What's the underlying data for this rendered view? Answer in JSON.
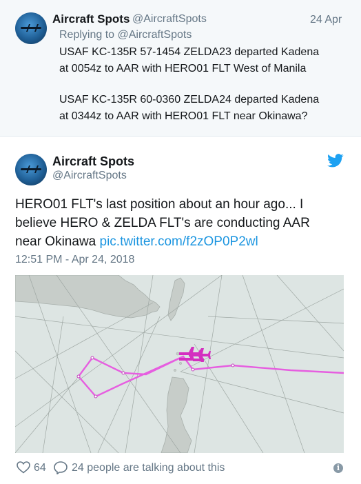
{
  "reply_tweet": {
    "name": "Aircraft Spots",
    "handle": "@AircraftSpots",
    "date": "24 Apr",
    "replying_to": "Replying to @AircraftSpots",
    "lines": [
      "USAF KC-135R 57-1454 ZELDA23 departed Kadena",
      "at 0054z to AAR with HERO01 FLT West of Manila",
      "USAF KC-135R 60-0360 ZELDA24 departed Kadena",
      "at 0344z to AAR with HERO01 FLT near Okinawa?"
    ]
  },
  "main_tweet": {
    "name": "Aircraft Spots",
    "handle": "@AircraftSpots",
    "text_line1": "HERO01 FLT's last position about an hour ago... I",
    "text_line2": "believe HERO & ZELDA FLT's are conducting AAR",
    "text_line3_prefix": "near Okinawa ",
    "link": "pic.twitter.com/f2zOP0P2wl",
    "timestamp": "12:51 PM - Apr 24, 2018"
  },
  "map": {
    "track_color": "#e65ee0",
    "aircraft_color": "#d42fc0",
    "land_color": "#c7cdc9",
    "water_color": "#dde5e3"
  },
  "footer": {
    "likes": "64",
    "talking": "24 people are talking about this"
  },
  "colors": {
    "link": "#1b95e0",
    "twitter_blue": "#1da1f2"
  }
}
